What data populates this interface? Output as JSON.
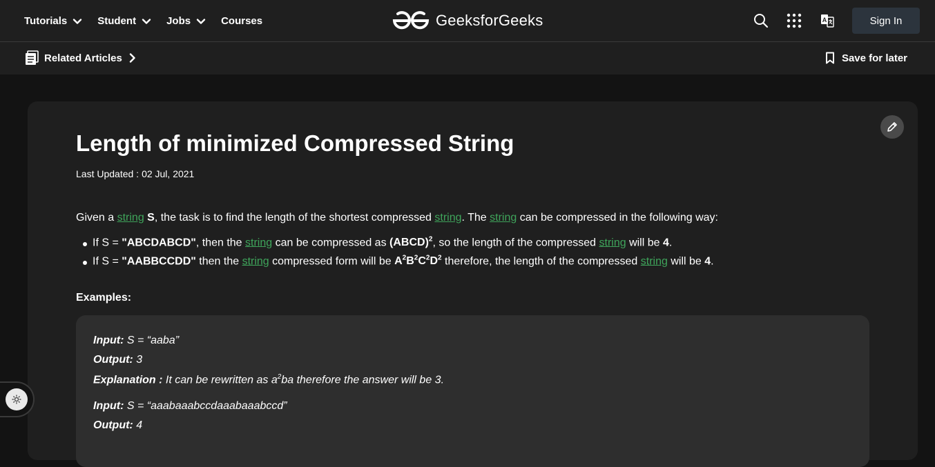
{
  "nav": {
    "items": [
      {
        "label": "Tutorials",
        "has_menu": true
      },
      {
        "label": "Student",
        "has_menu": true
      },
      {
        "label": "Jobs",
        "has_menu": true
      },
      {
        "label": "Courses",
        "has_menu": false
      }
    ],
    "logo_text": "GeeksforGeeks",
    "icons": [
      "search-icon",
      "apps-grid-icon",
      "translate-icon"
    ],
    "sign_in": "Sign In"
  },
  "subbar": {
    "related": "Related Articles",
    "save": "Save for later"
  },
  "article": {
    "title": "Length of minimized Compressed String",
    "updated_label": "Last Updated :",
    "updated_date": "02 Jul, 2021",
    "intro": {
      "p1": "Given a ",
      "link": "string",
      "s": "S",
      "p2": ", the task is to find the length of the shortest compressed ",
      "p3": ". The ",
      "p4": " can be compressed in the following way:"
    },
    "bullet1": {
      "a": "If S = ",
      "val": "\"ABCDABCD\"",
      "b": ", then the ",
      "c": " can be compressed as ",
      "form": "(ABCD)",
      "sup": "2",
      "d": ", so the length of the compressed ",
      "e": " will be ",
      "len": "4",
      "f": "."
    },
    "bullet2": {
      "a": "If S = ",
      "val": "\"AABBCCDD\"",
      "b": " then the ",
      "c": " compressed form will be ",
      "form": [
        "A",
        "B",
        "C",
        "D"
      ],
      "sup": "2",
      "d": " therefore, the length of the compressed ",
      "e": " will be ",
      "len": "4",
      "f": "."
    },
    "examples_heading": "Examples:",
    "examples": [
      {
        "input_label": "Input:",
        "input": " S = “aaba”",
        "output_label": "Output:",
        "output": " 3",
        "expl_label": "Explanation :",
        "expl_a": " It can be rewritten as a",
        "expl_sup": "2",
        "expl_b": "ba therefore the answer will be 3."
      },
      {
        "input_label": "Input:",
        "input": " S = “aaabaaabccdaaabaaabccd”",
        "output_label": "Output:",
        "output": " 4"
      }
    ]
  },
  "colors": {
    "link": "#3fa55b",
    "background": "#131313",
    "card": "#1f1f1f",
    "code_box": "#2e2e2e"
  }
}
